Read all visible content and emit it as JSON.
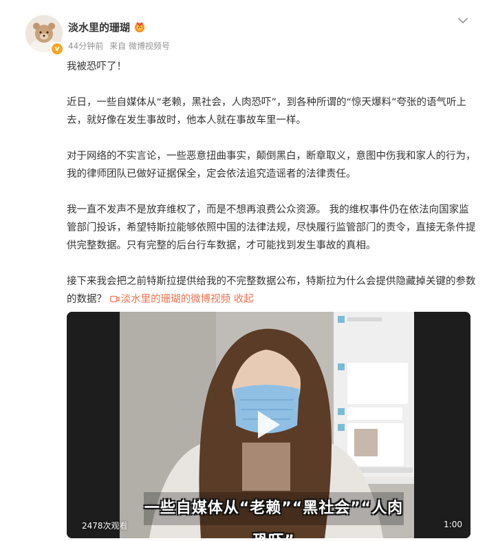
{
  "post": {
    "username": "淡水里的珊瑚",
    "time": "44分钟前",
    "source": "来自 微博视频号",
    "paragraphs": [
      "我被恐吓了！",
      "近日，一些自媒体从“老赖，黑社会，人肉恐吓”，到各种所谓的“惊天爆料”夸张的语气听上去，就好像在发生事故时，他本人就在事故车里一样。",
      "对于网络的不实言论，一些恶意扭曲事实，颠倒黑白，断章取义，意图中伤我和家人的行为，我的律师团队已做好证据保全，定会依法追究造谣者的法律责任。",
      "我一直不发声不是放弃维权了，而是不想再浪费公众资源。 我的维权事件仍在依法向国家监管部门投诉，希望特斯拉能够依照中国的法律法规，尽快履行监管部门的责令，直接无条件提供完整数据。只有完整的后台行车数据，才可能找到发生事故的真相。"
    ],
    "last_paragraph_text": "接下来我会把之前特斯拉提供给我的不完整数据公布，特斯拉为什么会提供隐藏掉关键的参数的数据？ ",
    "video_link_label": "淡水里的珊瑚的微博视频",
    "collapse_label": "收起"
  },
  "video": {
    "caption": "一些自媒体从“老赖”“黑社会”“人肉恐吓”",
    "views": "2478次观看",
    "duration": "1:00"
  },
  "icons": {
    "expand": "chevron-down-icon",
    "verified": "verified-badge-icon",
    "medal": "fan-medal-icon",
    "video_link": "video-camera-icon",
    "play": "play-icon"
  },
  "colors": {
    "accent_link": "#eb7350",
    "meta_gray": "#939393",
    "verified": "#f5a623"
  }
}
